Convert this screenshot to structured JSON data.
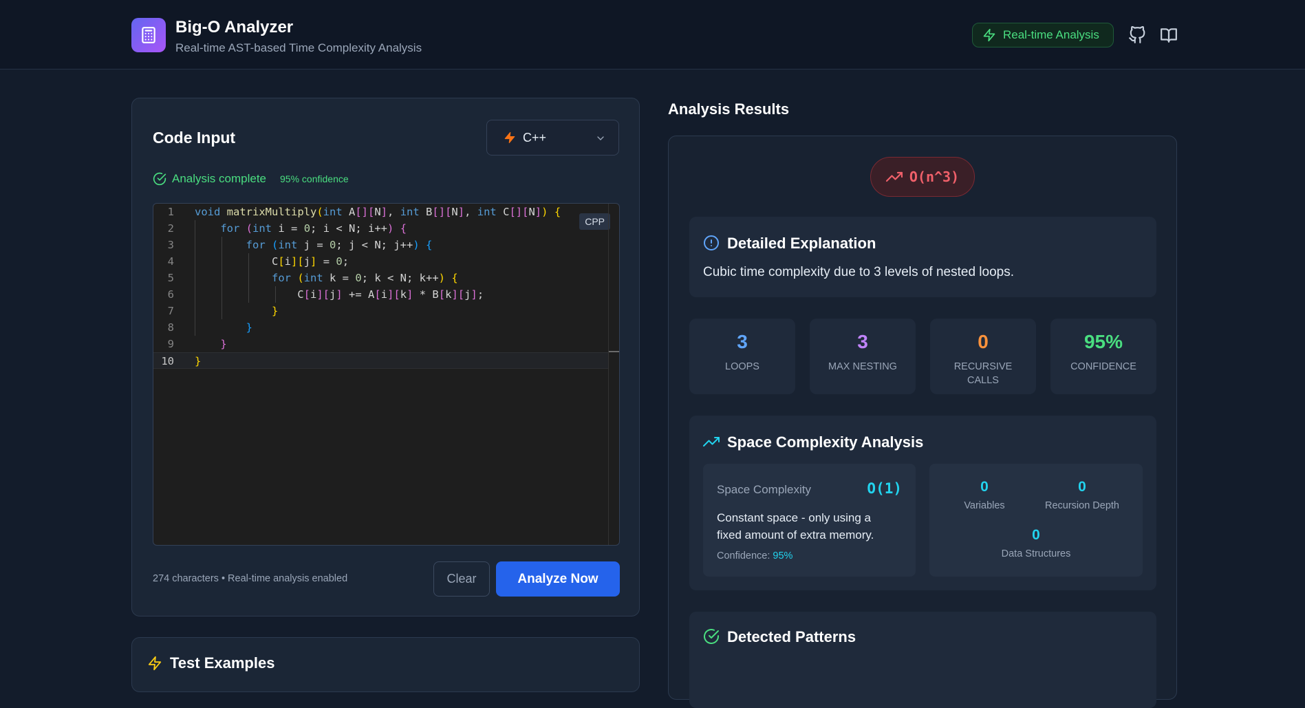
{
  "header": {
    "title": "Big-O Analyzer",
    "subtitle": "Real-time AST-based Time Complexity Analysis",
    "realtime_badge": "Real-time Analysis",
    "github_icon": "github-icon",
    "docs_icon": "book-icon"
  },
  "code_input": {
    "title": "Code Input",
    "language": "C++",
    "status": "Analysis complete",
    "confidence_badge": "95% confidence",
    "editor_badge": "CPP",
    "footer": "274 characters • Real-time analysis enabled",
    "clear_label": "Clear",
    "analyze_label": "Analyze Now",
    "line_numbers": [
      "1",
      "2",
      "3",
      "4",
      "5",
      "6",
      "7",
      "8",
      "9",
      "10"
    ],
    "code_lines": [
      "void matrixMultiply(int A[][N], int B[][N], int C[][N]) {",
      "    for (int i = 0; i < N; i++) {",
      "        for (int j = 0; j < N; j++) {",
      "            C[i][j] = 0;",
      "            for (int k = 0; k < N; k++) {",
      "                C[i][j] += A[i][k] * B[k][j];",
      "            }",
      "        }",
      "    }",
      "}"
    ]
  },
  "test_examples": {
    "title": "Test Examples"
  },
  "results": {
    "title": "Analysis Results",
    "time_complexity": "O(n^3)",
    "explanation_title": "Detailed Explanation",
    "explanation_text": "Cubic time complexity due to 3 levels of nested loops.",
    "stats": [
      {
        "value": "3",
        "label": "Loops",
        "color": "#60a5fa"
      },
      {
        "value": "3",
        "label": "Max Nesting",
        "color": "#c084fc"
      },
      {
        "value": "0",
        "label": "Recursive Calls",
        "color": "#fb923c"
      },
      {
        "value": "95%",
        "label": "Confidence",
        "color": "#4ade80"
      }
    ],
    "space": {
      "title": "Space Complexity Analysis",
      "label": "Space Complexity",
      "value": "O(1)",
      "description": "Constant space - only using a fixed amount of extra memory.",
      "confidence_label": "Confidence:",
      "confidence_value": "95%",
      "variables_value": "0",
      "variables_label": "Variables",
      "recursion_value": "0",
      "recursion_label": "Recursion Depth",
      "ds_value": "0",
      "ds_label": "Data Structures"
    },
    "patterns_title": "Detected Patterns"
  },
  "colors": {
    "accent_blue": "#2563eb",
    "success_green": "#4ade80",
    "danger_red": "#f0606a",
    "cyan": "#22d3ee"
  }
}
